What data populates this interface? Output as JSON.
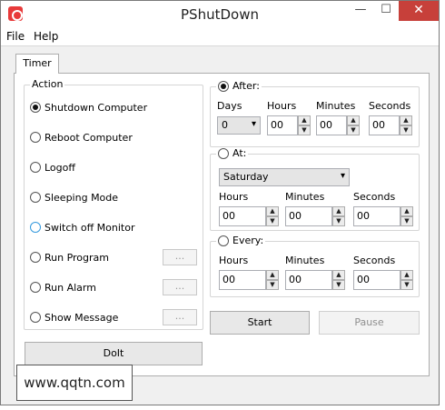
{
  "window": {
    "title": "PShutDown",
    "close_glyph": "✕",
    "min_glyph": "—",
    "max_glyph": "☐"
  },
  "menu": [
    "File",
    "Help"
  ],
  "tab": "Timer",
  "action": {
    "legend": "Action",
    "options": [
      {
        "label": "Shutdown Computer",
        "selected": true
      },
      {
        "label": "Reboot Computer",
        "selected": false
      },
      {
        "label": "Logoff",
        "selected": false
      },
      {
        "label": "Sleeping Mode",
        "selected": false
      },
      {
        "label": "Switch off Monitor",
        "selected": false
      },
      {
        "label": "Run Program",
        "selected": false
      },
      {
        "label": "Run Alarm",
        "selected": false
      },
      {
        "label": "Show Message",
        "selected": false
      }
    ],
    "browse_label": "...",
    "doit_label": "DoIt"
  },
  "after": {
    "label": "After:",
    "days_label": "Days",
    "days_value": "0",
    "hours_label": "Hours",
    "hours_value": "00",
    "minutes_label": "Minutes",
    "minutes_value": "00",
    "seconds_label": "Seconds",
    "seconds_value": "00"
  },
  "at": {
    "label": "At:",
    "day_value": "Saturday",
    "hours_label": "Hours",
    "hours_value": "00",
    "minutes_label": "Minutes",
    "minutes_value": "00",
    "seconds_label": "Seconds",
    "seconds_value": "00"
  },
  "every": {
    "label": "Every:",
    "hours_label": "Hours",
    "hours_value": "00",
    "minutes_label": "Minutes",
    "minutes_value": "00",
    "seconds_label": "Seconds",
    "seconds_value": "00"
  },
  "buttons": {
    "start": "Start",
    "pause": "Pause"
  },
  "watermark": "www.qqtn.com",
  "colors": {
    "close": "#c7403a",
    "app_icon": "#e83a3a"
  }
}
